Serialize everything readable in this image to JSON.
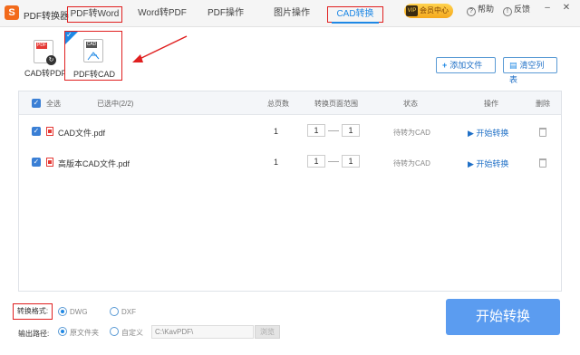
{
  "app": {
    "logo": "S",
    "title": "PDF转换器"
  },
  "nav": {
    "tabs": [
      {
        "label": "PDF转Word"
      },
      {
        "label": "Word转PDF"
      },
      {
        "label": "PDF操作"
      },
      {
        "label": "图片操作"
      },
      {
        "label": "CAD转换"
      }
    ]
  },
  "top_right": {
    "vip_badge": "VIP",
    "vip_label": "会员中心",
    "help_label": "帮助",
    "feedback_label": "反馈"
  },
  "tools": [
    {
      "label": "CAD转PDF",
      "icon": "cad-to-pdf-icon"
    },
    {
      "label": "PDF转CAD",
      "icon": "pdf-to-cad-icon"
    }
  ],
  "actions": {
    "add_files": "添加文件",
    "clear_list": "清空列表"
  },
  "table": {
    "headers": {
      "select_all": "全选",
      "selected": "已选中(2/2)",
      "total_pages": "总页数",
      "page_range": "转换页面范围",
      "status": "状态",
      "action": "操作",
      "delete": "删除"
    },
    "rows": [
      {
        "name": "CAD文件.pdf",
        "pages": "1",
        "from": "1",
        "to": "1",
        "status": "待转为CAD",
        "action": "开始转换"
      },
      {
        "name": "高版本CAD文件.pdf",
        "pages": "1",
        "from": "1",
        "to": "1",
        "status": "待转为CAD",
        "action": "开始转换"
      }
    ]
  },
  "bottom": {
    "format_label": "转换格式:",
    "formats": [
      "DWG",
      "DXF"
    ],
    "selected_format": "DWG",
    "output_label": "输出路径:",
    "output_options": [
      "原文件夹",
      "自定义"
    ],
    "selected_output": "原文件夹",
    "path_value": "C:\\KavPDF\\",
    "browse_label": "浏览",
    "start_button": "开始转换"
  },
  "colors": {
    "accent": "#1e88e5",
    "highlight_box": "#e02020",
    "start_button": "#5b9cf0"
  }
}
